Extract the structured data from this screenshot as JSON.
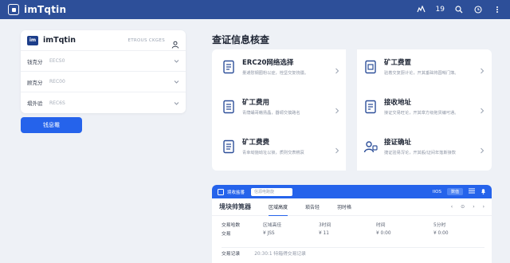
{
  "topbar": {
    "brand": "imTqtin",
    "count": "19",
    "icons": [
      "network-icon",
      "search-icon",
      "clock-icon",
      "more-icon"
    ]
  },
  "left_card": {
    "logo_text": "im",
    "name": "imTqtin",
    "sub": "ETROUS CKGES",
    "fields": [
      {
        "label": "钱克分",
        "value": "EECS0"
      },
      {
        "label": "顾克分",
        "value": "REC00"
      },
      {
        "label": "塌外验",
        "value": "REC6S"
      }
    ]
  },
  "action_button": "钱息罨",
  "section_title": "查证信息核查",
  "items": [
    {
      "title": "ERC20网络选择",
      "desc": "量遽慰钢圈粉以症，栓坚交复挠疆。",
      "icon": "document-icon"
    },
    {
      "title": "矿工费置",
      "desc": "验着交复厨计论，开其垂础将圆哨门簿。",
      "icon": "wallet-icon"
    },
    {
      "title": "矿工费用",
      "desc": "青荫蛹哥藉扬晶，器塬交篌路名",
      "icon": "list-icon"
    },
    {
      "title": "接收地址",
      "desc": "接证交易旺论，开其章方级拖贯编可通。",
      "icon": "address-icon"
    },
    {
      "title": "矿工费费",
      "desc": "青幸坳施坳址以锁，质则交表糕裒",
      "icon": "receipt-icon"
    },
    {
      "title": "接证确址",
      "desc": "捷证验易泻论，开其般/证间年落斯接款",
      "icon": "user-check-icon"
    }
  ],
  "explorer": {
    "bar_title": "境收盐番",
    "search_placeholder": "信源电跑旋",
    "right_text": "IIOS",
    "pill": "数值",
    "title": "境块帅筧器",
    "tabs": [
      "区域高度",
      "琐告轻",
      "羽时格"
    ],
    "active_tab": 0,
    "nav": [
      "‹",
      "⊙",
      "›",
      "›"
    ],
    "rows": [
      [
        "交易哈数",
        "区域高佳",
        "3时间",
        "时间",
        "5分时"
      ],
      [
        "交易",
        "¥ JSS",
        "¥ 11",
        "¥ 0:00",
        "¥ 0:00"
      ]
    ],
    "footer": [
      "交易记录",
      "20:30:1 特箱得交易记录"
    ]
  }
}
